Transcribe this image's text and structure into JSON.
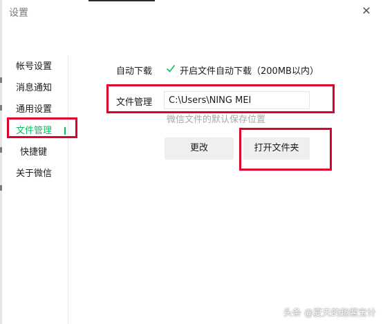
{
  "window": {
    "title": "设置",
    "close_glyph": "✕"
  },
  "sidebar": {
    "items": [
      {
        "label": "帐号设置",
        "active": false
      },
      {
        "label": "消息通知",
        "active": false
      },
      {
        "label": "通用设置",
        "active": false
      },
      {
        "label": "文件管理",
        "active": true
      },
      {
        "label": "快捷键",
        "active": false
      },
      {
        "label": "关于微信",
        "active": false
      }
    ]
  },
  "file_settings": {
    "auto_download_label": "自动下载",
    "auto_download_checkbox_text": "开启文件自动下载（200MB以内）",
    "auto_download_checked": true,
    "file_manage_label": "文件管理",
    "path_value": "C:\\Users\\NING MEI",
    "path_hint": "微信文件的默认保存位置",
    "change_button": "更改",
    "open_folder_button": "打开文件夹"
  },
  "watermark": "头条 @夏天的趣酱宝计",
  "colors": {
    "accent": "#07c160",
    "highlight_box": "#e0002a",
    "button_bg": "#efefef",
    "hint": "#a8a8a8"
  }
}
